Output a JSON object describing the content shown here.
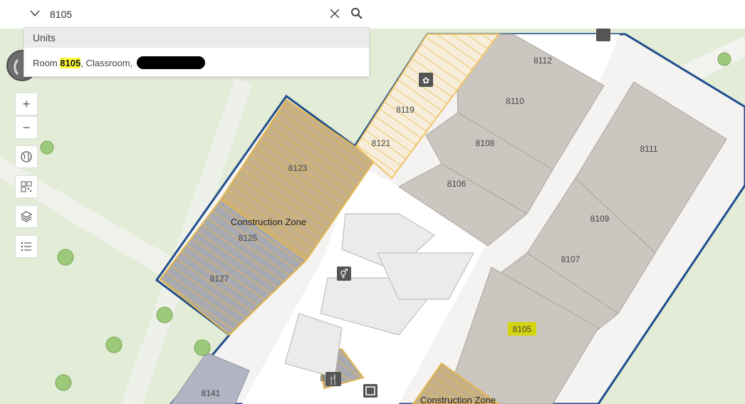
{
  "search": {
    "value": "8105",
    "placeholder": "",
    "suggestion_group": "Units",
    "suggestion": {
      "prefix": "Room ",
      "match": "8105",
      "suffix": ", Classroom, "
    }
  },
  "map": {
    "rooms": {
      "r8112": "8112",
      "r8110": "8110",
      "r8111": "8111",
      "r8108": "8108",
      "r8106": "8106",
      "r8109": "8109",
      "r8107": "8107",
      "r8105": "8105",
      "r8119": "8119",
      "r8121": "8121",
      "r8123": "8123",
      "r8125": "8125",
      "r8127": "8127",
      "r8141": "8141",
      "r81x": "81   H"
    },
    "zones": {
      "construction_1": "Construction Zone",
      "construction_2": "Construction Zone"
    }
  },
  "colors": {
    "building_outline": "#1f4e8c",
    "construction": "#e3b64d",
    "room_fill": "#cbc6bf",
    "highlight": "#d4d40e"
  }
}
